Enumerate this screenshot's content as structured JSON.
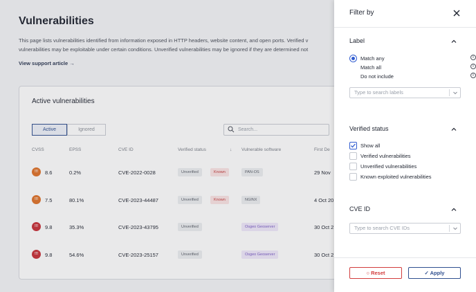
{
  "page": {
    "title": "Vulnerabilities",
    "description_line1": "This page lists vulnerabilities identified from information exposed in HTTP headers, website content, and open ports. Verified v",
    "description_line2": "vulnerabilities may be exploitable under certain conditions. Unverified vulnerabilities may be ignored if they are determined not",
    "support_link": "View support article",
    "card_title": "Active vulnerabilities",
    "tabs": [
      "Active",
      "Ignored"
    ],
    "search_placeholder": "Search...",
    "columns": [
      "CVSS",
      "EPSS",
      "CVE ID",
      "Verified status",
      "Vulnerable software",
      "First De"
    ],
    "rows": [
      {
        "cvss": "8.6",
        "epss": "0.2%",
        "cve": "CVE-2022-0028",
        "status": "Unverified",
        "known": "Known",
        "software": "PAN-OS",
        "first": "29 Nov",
        "sev_color": "#e0742b"
      },
      {
        "cvss": "7.5",
        "epss": "80.1%",
        "cve": "CVE-2023-44487",
        "status": "Unverified",
        "known": "Known",
        "software": "NGINX",
        "first": "4 Oct 20",
        "sev_color": "#e0742b"
      },
      {
        "cvss": "9.8",
        "epss": "35.3%",
        "cve": "CVE-2023-43795",
        "status": "Unverified",
        "known": "",
        "software": "Osgeo Geoserver",
        "first": "30 Oct 2",
        "sev_color": "#c8323a"
      },
      {
        "cvss": "9.8",
        "epss": "54.6%",
        "cve": "CVE-2023-25157",
        "status": "Unverified",
        "known": "",
        "software": "Osgeo Geoserver",
        "first": "30 Oct 2",
        "sev_color": "#c8323a"
      }
    ]
  },
  "drawer": {
    "title": "Filter by",
    "label_section": {
      "heading": "Label",
      "options": [
        "Match any",
        "Match all",
        "Do not include"
      ],
      "selected": "Match any",
      "search_placeholder": "Type to search labels"
    },
    "verified_section": {
      "heading": "Verified status",
      "options": [
        "Show all",
        "Verified vulnerabilities",
        "Unverified vulnerabilities",
        "Known exploited vulnerabilities"
      ],
      "checked": "Show all"
    },
    "cve_section": {
      "heading": "CVE ID",
      "search_placeholder": "Type to search CVE IDs"
    },
    "reset_label": "Reset",
    "apply_label": "Apply"
  },
  "colors": {
    "accent": "#2f5bd0",
    "reset": "#d23c3c",
    "apply": "#2f4f8f"
  }
}
